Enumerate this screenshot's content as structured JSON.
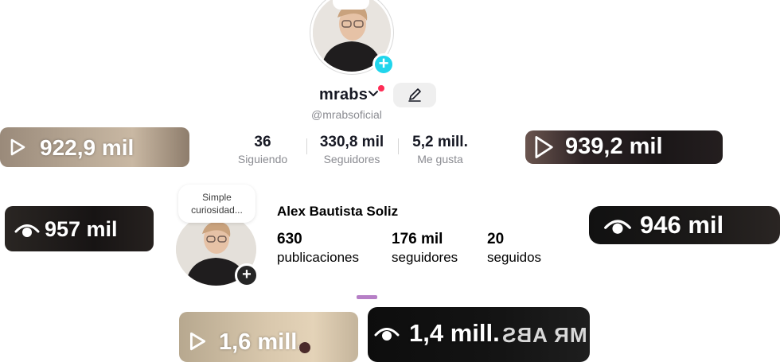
{
  "tiktok": {
    "username": "mrabs",
    "handle": "@mrabsoficial",
    "stats": [
      {
        "value": "36",
        "label": "Siguiendo"
      },
      {
        "value": "330,8 mil",
        "label": "Seguidores"
      },
      {
        "value": "5,2 mill.",
        "label": "Me gusta"
      }
    ],
    "plus_glyph": "+",
    "accent": "#20d5ec",
    "live_dot": "#fe2c55"
  },
  "instagram": {
    "note_line1": "Simple",
    "note_line2": "curiosidad...",
    "name": "Alex Bautista Soliz",
    "stats": [
      {
        "value": "630",
        "label": "publicaciones"
      },
      {
        "value": "176 mil",
        "label": "seguidores"
      },
      {
        "value": "20",
        "label": "seguidos"
      }
    ],
    "plus_glyph": "+"
  },
  "view_badges": [
    {
      "icon": "play-icon",
      "count": "922,9 mil"
    },
    {
      "icon": "play-icon",
      "count": "939,2 mil"
    },
    {
      "icon": "eye-icon",
      "count": "957 mil"
    },
    {
      "icon": "eye-icon",
      "count": "946 mil"
    },
    {
      "icon": "play-icon",
      "count": "1,6 mill."
    },
    {
      "icon": "eye-icon",
      "count": "1,4 mill."
    }
  ],
  "mirrored_watermark": "MR ABS"
}
